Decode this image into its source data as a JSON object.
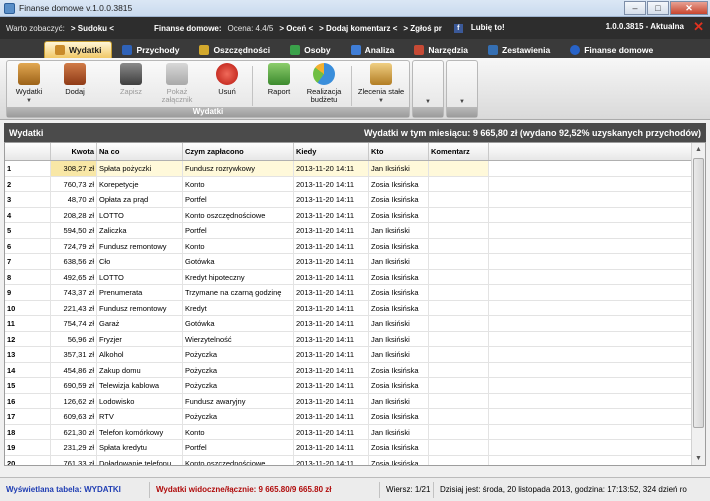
{
  "window": {
    "title": "Finanse domowe v.1.0.0.3815",
    "minimize": "–",
    "maximize": "□",
    "close": "✕"
  },
  "infobar": {
    "worth_label": "Warto zobaczyć:",
    "sudoku": "> Sudoku <",
    "app_label": "Finanse domowe:",
    "rating": "Ocena: 4.4/5",
    "rate": "> Oceń <",
    "comment": "> Dodaj komentarz <",
    "report": "> Zgłoś pr",
    "like": "Lubię to!",
    "version": "1.0.0.3815 - Aktualna"
  },
  "tabs": [
    {
      "label": "Wydatki",
      "active": true,
      "color": "#c98b2a"
    },
    {
      "label": "Przychody",
      "active": false,
      "color": "#2f62b8"
    },
    {
      "label": "Oszczędności",
      "active": false,
      "color": "#d2a82d"
    },
    {
      "label": "Osoby",
      "active": false,
      "color": "#3aa14a"
    },
    {
      "label": "Analiza",
      "active": false,
      "color": "#3f7dd6"
    },
    {
      "label": "Narzędzia",
      "active": false,
      "color": "#c64a35"
    },
    {
      "label": "Zestawienia",
      "active": false,
      "color": "#356fb3"
    },
    {
      "label": "Finanse domowe",
      "active": false,
      "color": "#2863c8"
    }
  ],
  "ribbon": {
    "group_label": "Wydatki",
    "buttons": [
      {
        "label": "Wydatki",
        "enabled": true,
        "color": "#c58730"
      },
      {
        "label": "Dodaj",
        "enabled": true,
        "color": "#b5542c"
      },
      {
        "label": "Zapisz",
        "enabled": false,
        "color": "#6c6c6c"
      },
      {
        "label": "Pokaż załącznik",
        "enabled": false,
        "color": "#a0a0a0"
      },
      {
        "label": "Usuń",
        "enabled": true,
        "color": "#d92b21"
      },
      {
        "label": "Raport",
        "enabled": true,
        "color": "#4b9a3b"
      },
      {
        "label": "Realizacja budżetu",
        "enabled": true,
        "color": "#3a8edb"
      },
      {
        "label": "Zlecenia stałe",
        "enabled": true,
        "color": "#d6a84b"
      }
    ]
  },
  "section": {
    "title": "Wydatki",
    "summary": "Wydatki w tym miesiącu: 9 665,80 zł (wydano 92,52% uzyskanych przychodów)"
  },
  "table": {
    "columns": [
      "Kwota",
      "Na co",
      "Czym zapłacono",
      "Kiedy",
      "Kto",
      "Komentarz"
    ],
    "rows": [
      [
        "1",
        "308,27 zł",
        "Spłata pożyczki",
        "Fundusz rozrywkowy",
        "2013-11-20 14:11",
        "Jan Iksiński",
        ""
      ],
      [
        "2",
        "760,73 zł",
        "Korepetycje",
        "Konto",
        "2013-11-20 14:11",
        "Zosia Iksińska",
        ""
      ],
      [
        "3",
        "48,70 zł",
        "Opłata za prąd",
        "Portfel",
        "2013-11-20 14:11",
        "Zosia Iksińska",
        ""
      ],
      [
        "4",
        "208,28 zł",
        "LOTTO",
        "Konto oszczędnościowe",
        "2013-11-20 14:11",
        "Zosia Iksińska",
        ""
      ],
      [
        "5",
        "594,50 zł",
        "Zaliczka",
        "Portfel",
        "2013-11-20 14:11",
        "Jan Iksiński",
        ""
      ],
      [
        "6",
        "724,79 zł",
        "Fundusz remontowy",
        "Konto",
        "2013-11-20 14:11",
        "Zosia Iksińska",
        ""
      ],
      [
        "7",
        "638,56 zł",
        "Cło",
        "Gotówka",
        "2013-11-20 14:11",
        "Jan Iksiński",
        ""
      ],
      [
        "8",
        "492,65 zł",
        "LOTTO",
        "Kredyt hipoteczny",
        "2013-11-20 14:11",
        "Zosia Iksińska",
        ""
      ],
      [
        "9",
        "743,37 zł",
        "Prenumerata",
        "Trzymane na czarną godzinę",
        "2013-11-20 14:11",
        "Zosia Iksińska",
        ""
      ],
      [
        "10",
        "221,43 zł",
        "Fundusz remontowy",
        "Kredyt",
        "2013-11-20 14:11",
        "Zosia Iksińska",
        ""
      ],
      [
        "11",
        "754,74 zł",
        "Garaż",
        "Gotówka",
        "2013-11-20 14:11",
        "Jan Iksiński",
        ""
      ],
      [
        "12",
        "56,96 zł",
        "Fryzjer",
        "Wierzytelność",
        "2013-11-20 14:11",
        "Jan Iksiński",
        ""
      ],
      [
        "13",
        "357,31 zł",
        "Alkohol",
        "Pożyczka",
        "2013-11-20 14:11",
        "Jan Iksiński",
        ""
      ],
      [
        "14",
        "454,86 zł",
        "Zakup domu",
        "Pożyczka",
        "2013-11-20 14:11",
        "Zosia Iksińska",
        ""
      ],
      [
        "15",
        "690,59 zł",
        "Telewizja kablowa",
        "Pożyczka",
        "2013-11-20 14:11",
        "Zosia Iksińska",
        ""
      ],
      [
        "16",
        "126,62 zł",
        "Lodowisko",
        "Fundusz awaryjny",
        "2013-11-20 14:11",
        "Jan Iksiński",
        ""
      ],
      [
        "17",
        "609,63 zł",
        "RTV",
        "Pożyczka",
        "2013-11-20 14:11",
        "Zosia Iksińska",
        ""
      ],
      [
        "18",
        "621,30 zł",
        "Telefon komórkowy",
        "Konto",
        "2013-11-20 14:11",
        "Jan Iksiński",
        ""
      ],
      [
        "19",
        "231,29 zł",
        "Spłata kredytu",
        "Portfel",
        "2013-11-20 14:11",
        "Zosia Iksińska",
        ""
      ],
      [
        "20",
        "761,33 zł",
        "Doładowanie telefonu",
        "Konto oszczędnościowe",
        "2013-11-20 14:11",
        "Zosia Iksińska",
        ""
      ]
    ]
  },
  "status": {
    "table_label": "Wyświetlana tabela: WYDATKI",
    "visible_total": "Wydatki widoczne/łącznie: 9 665.80/9 665.80 zł",
    "row_info": "Wiersz: 1/21",
    "date_info": "Dzisiaj jest: środa, 20 listopada 2013, godzina: 17:13:52, 324 dzień ro"
  }
}
